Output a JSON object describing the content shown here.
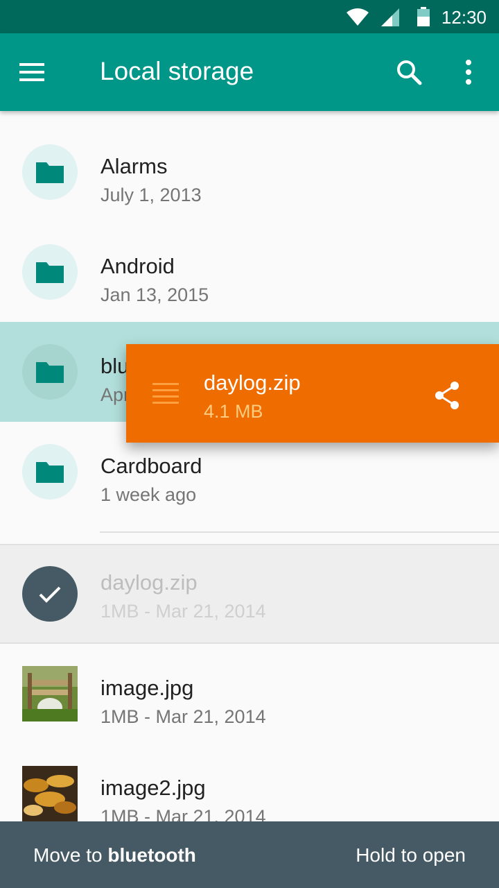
{
  "status_bar": {
    "time": "12:30"
  },
  "app_bar": {
    "title": "Local storage"
  },
  "folders": [
    {
      "name": "Alarms",
      "meta": "July 1, 2013"
    },
    {
      "name": "Android",
      "meta": "Jan 13, 2015"
    },
    {
      "name": "blu",
      "meta": "Apr"
    },
    {
      "name": "Cardboard",
      "meta": "1 week ago"
    }
  ],
  "selected_file": {
    "name": "daylog.zip",
    "meta": "1MB - Mar 21, 2014"
  },
  "files": [
    {
      "name": "image.jpg",
      "meta": "1MB - Mar 21, 2014"
    },
    {
      "name": "image2.jpg",
      "meta": "1MB - Mar 21, 2014"
    }
  ],
  "drag_item": {
    "name": "daylog.zip",
    "meta": "4.1 MB"
  },
  "bottom_bar": {
    "move_prefix": "Move to ",
    "move_target": "bluetooth",
    "hold_label": "Hold to open"
  },
  "colors": {
    "primary": "#009688",
    "primary_dark": "#00695c",
    "drag_accent": "#ef6c00",
    "bottom_bar": "#455a64"
  }
}
